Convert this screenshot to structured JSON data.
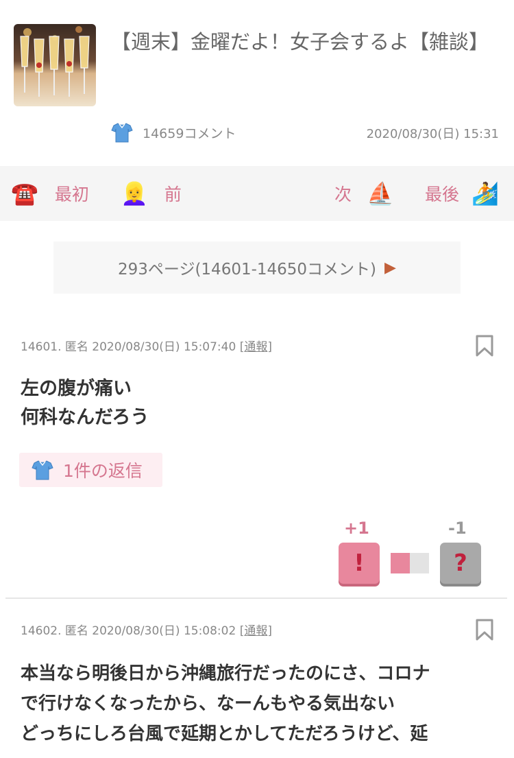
{
  "thread": {
    "title": "【週末】金曜だよ！女子会するよ【雑談】",
    "comment_count": "14659コメント",
    "date": "2020/08/30(日) 15:31"
  },
  "nav": {
    "first": {
      "label": "最初",
      "emoji": "☎️"
    },
    "prev": {
      "label": "前",
      "emoji": "👱‍♀️"
    },
    "next": {
      "label": "次",
      "emoji": "⛵"
    },
    "last": {
      "label": "最後",
      "emoji": "🏄"
    }
  },
  "pagination": {
    "label": "293ページ(14601-14650コメント)",
    "arrow": "▶"
  },
  "comments": [
    {
      "header": "14601. 匿名 2020/08/30(日) 15:07:40",
      "report": "通報",
      "bracket_open": "[",
      "bracket_close": "]",
      "lines": [
        "左の腹が痛い",
        "何科なんだろう"
      ],
      "reply_label": "1件の返信",
      "plus": "+1",
      "minus": "-1",
      "plus_icon": "!",
      "minus_icon": "?",
      "plus_ratio": 0.5
    },
    {
      "header": "14602. 匿名 2020/08/30(日) 15:08:02",
      "report": "通報",
      "bracket_open": "[",
      "bracket_close": "]",
      "lines": [
        "本当なら明後日から沖縄旅行だったのにさ、コロナ",
        "で行けなくなったから、なーんもやる気出ない",
        "どっちにしろ台風で延期とかしてただろうけど、延"
      ]
    }
  ],
  "colors": {
    "accent_pink": "#d5768f",
    "plus_pink": "#e8879d",
    "minus_gray": "#a9a9a9",
    "nav_bg": "#f5f5f5"
  }
}
